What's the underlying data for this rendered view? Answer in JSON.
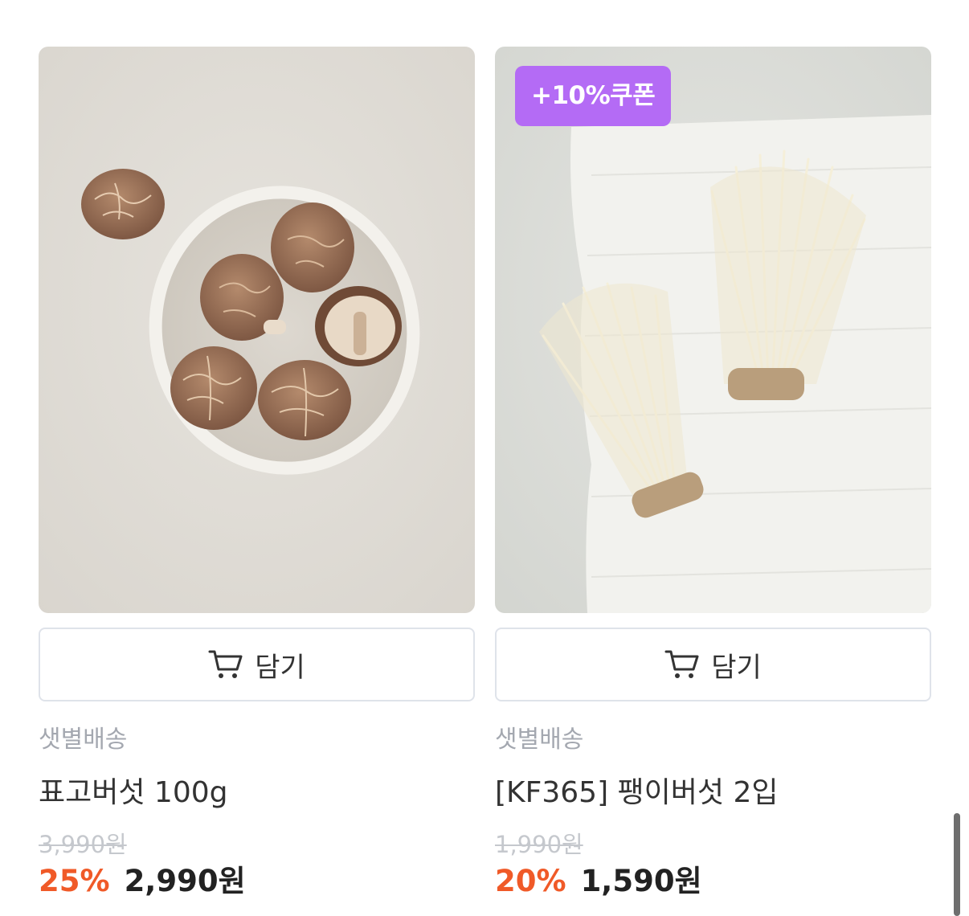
{
  "products": [
    {
      "image_alt": "shiitake mushrooms on a plate",
      "coupon": "",
      "cart_label": "담기",
      "delivery": "샛별배송",
      "name": "표고버섯 100g",
      "original_price": "3,990원",
      "discount": "25%",
      "price": "2,990원"
    },
    {
      "image_alt": "enoki mushrooms on a cloth",
      "coupon": "+10%쿠폰",
      "cart_label": "담기",
      "delivery": "샛별배송",
      "name": "[KF365] 팽이버섯 2입",
      "original_price": "1,990원",
      "discount": "20%",
      "price": "1,590원"
    }
  ],
  "colors": {
    "discount": "#f05a28",
    "coupon_bg": "#b46bf5",
    "muted": "#a4a8b0"
  },
  "icons": {
    "cart": "cart-icon"
  }
}
